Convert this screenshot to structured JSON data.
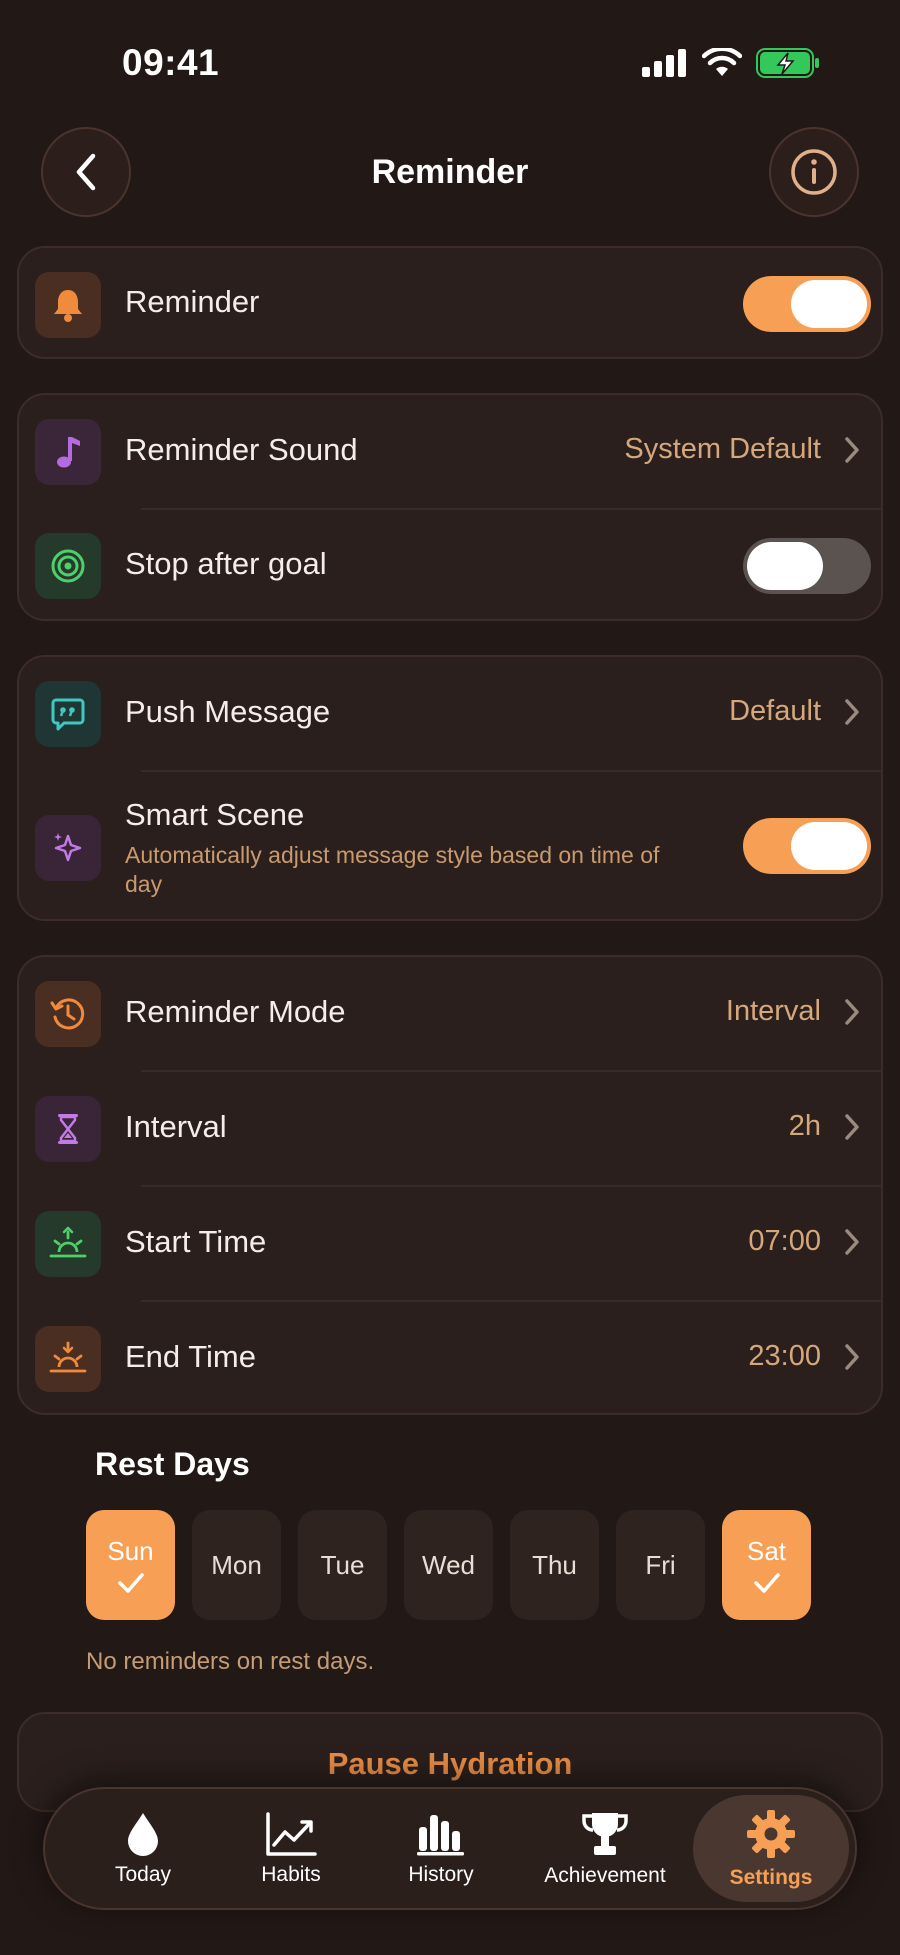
{
  "status": {
    "time": "09:41"
  },
  "header": {
    "title": "Reminder"
  },
  "reminder_card": {
    "label": "Reminder",
    "enabled": true
  },
  "sound_card": {
    "sound_label": "Reminder Sound",
    "sound_value": "System Default",
    "stop_label": "Stop after goal",
    "stop_enabled": false
  },
  "message_card": {
    "push_label": "Push Message",
    "push_value": "Default",
    "scene_label": "Smart Scene",
    "scene_desc": "Automatically adjust message style based on time of day",
    "scene_enabled": true
  },
  "schedule_card": {
    "mode_label": "Reminder Mode",
    "mode_value": "Interval",
    "interval_label": "Interval",
    "interval_value": "2h",
    "start_label": "Start Time",
    "start_value": "07:00",
    "end_label": "End Time",
    "end_value": "23:00"
  },
  "rest_days": {
    "title": "Rest Days",
    "days": [
      {
        "label": "Sun",
        "selected": true
      },
      {
        "label": "Mon",
        "selected": false
      },
      {
        "label": "Tue",
        "selected": false
      },
      {
        "label": "Wed",
        "selected": false
      },
      {
        "label": "Thu",
        "selected": false
      },
      {
        "label": "Fri",
        "selected": false
      },
      {
        "label": "Sat",
        "selected": true
      }
    ],
    "note": "No reminders on rest days."
  },
  "pause": {
    "label": "Pause Hydration"
  },
  "tabbar": {
    "items": [
      {
        "label": "Today",
        "icon": "drop-icon"
      },
      {
        "label": "Habits",
        "icon": "chart-line-icon"
      },
      {
        "label": "History",
        "icon": "bar-chart-icon"
      },
      {
        "label": "Achievement",
        "icon": "trophy-icon"
      },
      {
        "label": "Settings",
        "icon": "gear-icon",
        "active": true
      }
    ]
  },
  "colors": {
    "accent": "#f7a055",
    "background": "#221816",
    "card": "#2a1f1c",
    "value_text": "#d4a87c"
  }
}
